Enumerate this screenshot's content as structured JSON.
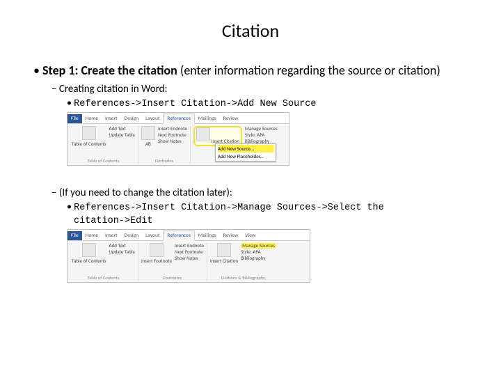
{
  "title": "Citation",
  "step1": {
    "heading_bold": "Step 1: Create the citation",
    "heading_rest": " (enter information regarding the source or citation)",
    "sub_a": "Creating citation in Word:",
    "path_a": "References->Insert Citation->Add New Source",
    "sub_b": "(If you need to change the citation  later):",
    "path_b": "References->Insert Citation->Manage Sources->Select the",
    "path_b2": "citation->Edit"
  },
  "ribbon": {
    "tabs": {
      "file": "File",
      "home": "Home",
      "insert": "Insert",
      "design": "Design",
      "layout": "Layout",
      "references": "References",
      "mailings": "Mailings",
      "review": "Review",
      "view": "View"
    },
    "toc_group": {
      "label": "Table of Contents",
      "add_text": "Add Text",
      "update_table": "Update Table",
      "toc": "Table of\nContents"
    },
    "footnotes_group": {
      "label": "Footnotes",
      "insert_footnote": "Insert Footnote",
      "insert_endnote": "Insert Endnote",
      "next_footnote": "Next Footnote",
      "show_notes": "Show Notes",
      "ab": "AB"
    },
    "citations_group": {
      "label": "Citations & Bibliography",
      "insert_citation": "Insert\nCitation",
      "manage_sources": "Manage Sources",
      "style": "Style: APA",
      "bibliography": "Bibliography"
    },
    "dropdown": {
      "add_new_source": "Add New Source...",
      "add_new_placeholder": "Add New Placeholder..."
    }
  }
}
